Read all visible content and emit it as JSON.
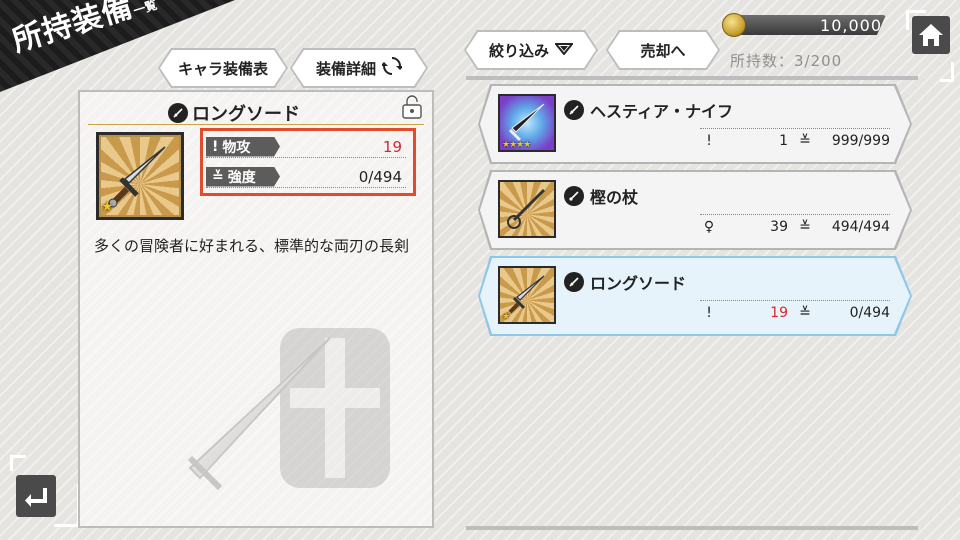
{
  "header": {
    "title": "所持装備",
    "subtitle": "一覧",
    "gold": "10,000",
    "possession": "所持数：3/200"
  },
  "buttons": {
    "char_equip": "キャラ装備表",
    "equip_detail": "装備詳細",
    "filter": "絞り込み",
    "sell": "売却へ"
  },
  "detail": {
    "name": "ロングソード",
    "stats": [
      {
        "label": "物攻",
        "value": "19"
      },
      {
        "label": "強度",
        "value": "0/494"
      }
    ],
    "description": "多くの冒険者に好まれる、標準的な両刃の長剣",
    "rarity_stars": "★"
  },
  "items": [
    {
      "name": "ヘスティア・ナイフ",
      "stat1": "1",
      "stat2": "999/999",
      "stars": "★★★★",
      "selected": false
    },
    {
      "name": "樫の杖",
      "stat1": "39",
      "stat2": "494/494",
      "stars": "",
      "selected": false
    },
    {
      "name": "ロングソード",
      "stat1": "19",
      "stat2": "0/494",
      "stars": "★",
      "selected": true
    }
  ],
  "colors": {
    "highlight": "#e24b2c",
    "stat_red": "#d8262a",
    "selected_border": "#8fc7e8"
  },
  "icons": {
    "home": "home-icon",
    "back": "back-arrow-icon",
    "lock": "unlock-icon",
    "refresh": "refresh-icon",
    "filter": "triangle-down-icon",
    "coin": "coin-icon"
  }
}
